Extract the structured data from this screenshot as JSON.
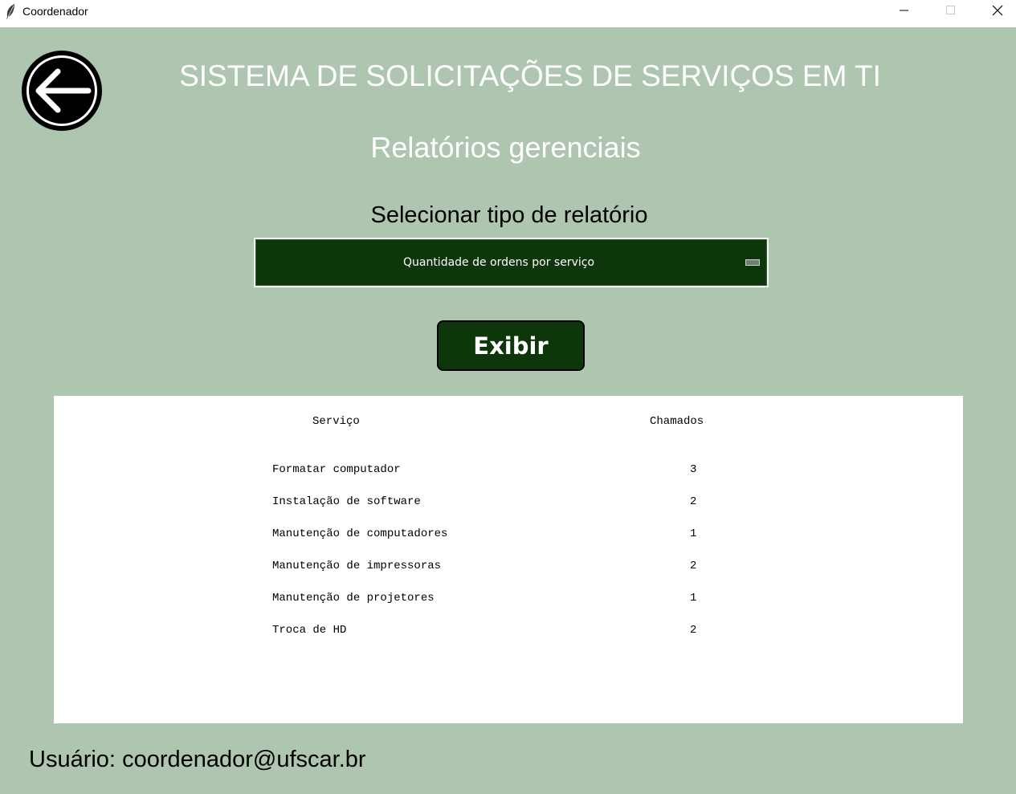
{
  "window": {
    "title": "Coordenador"
  },
  "header": {
    "app_title": "SISTEMA DE SOLICITAÇÕES DE SERVIÇOS EM TI",
    "page_title": "Relatórios gerenciais"
  },
  "report_selector": {
    "label": "Selecionar tipo de relatório",
    "selected_value": "Quantidade de ordens por serviço"
  },
  "actions": {
    "show_label": "Exibir"
  },
  "report": {
    "columns": [
      "Serviço",
      "Chamados"
    ],
    "rows": [
      {
        "service": "Formatar computador",
        "calls": "3"
      },
      {
        "service": "Instalação de software",
        "calls": "2"
      },
      {
        "service": "Manutenção de computadores",
        "calls": "1"
      },
      {
        "service": "Manutenção de impressoras",
        "calls": "2"
      },
      {
        "service": "Manutenção de projetores",
        "calls": "1"
      },
      {
        "service": "Troca de HD",
        "calls": "2"
      }
    ]
  },
  "footer": {
    "user_label": "Usuário:",
    "user_email": "coordenador@ufscar.br"
  },
  "colors": {
    "background": "#aec6af",
    "accent_dark_green": "#0d360b",
    "panel": "#ffffff"
  },
  "icons": {
    "back": "arrow-left-circle-icon",
    "app": "feather-icon",
    "minimize": "minimize-icon",
    "maximize": "maximize-icon",
    "close": "close-icon"
  }
}
